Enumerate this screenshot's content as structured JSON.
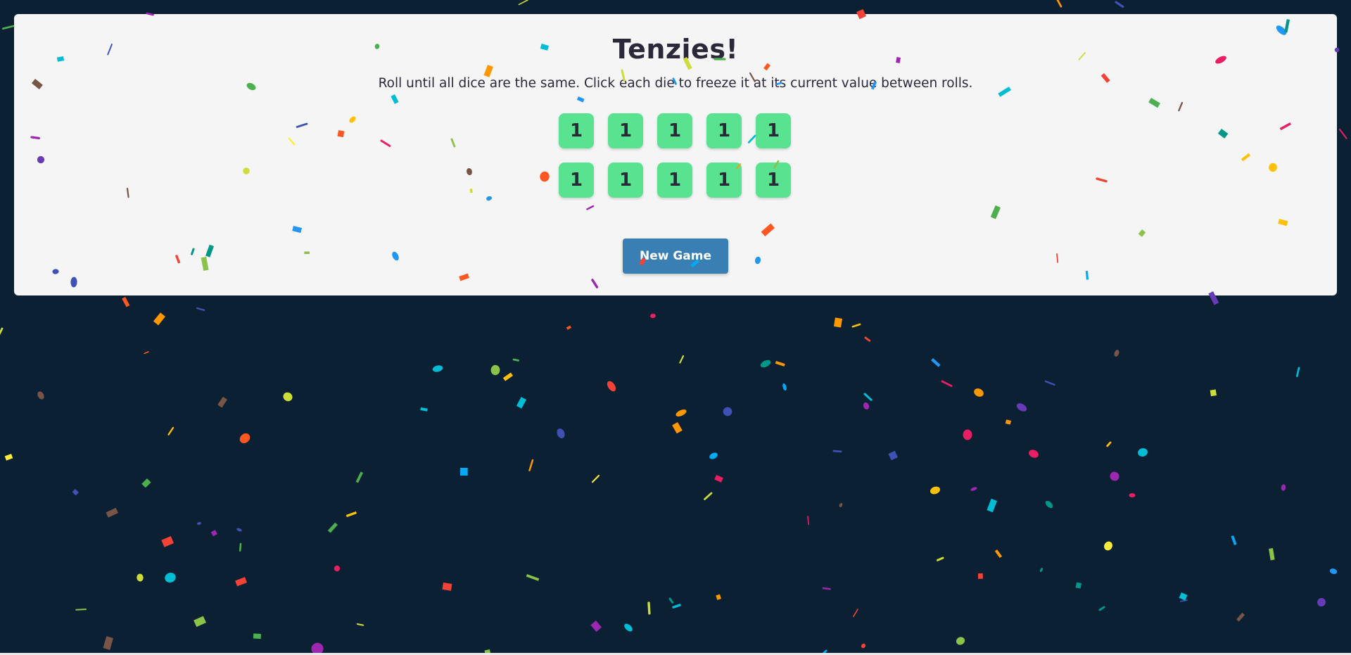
{
  "game": {
    "title": "Tenzies!",
    "instructions": "Roll until all dice are the same. Click each die to freeze it at its current value between rolls.",
    "dice": [
      "1",
      "1",
      "1",
      "1",
      "1",
      "1",
      "1",
      "1",
      "1",
      "1"
    ],
    "button_label": "New Game",
    "won": true
  },
  "theme": {
    "background": "#0b2133",
    "card": "#f5f5f5",
    "die_held": "#59e391",
    "button": "#3a7fb3",
    "text": "#2b283a"
  },
  "confetti_colors": [
    "#f44336",
    "#e91e63",
    "#9c27b0",
    "#673ab7",
    "#3f51b5",
    "#2196f3",
    "#03a9f4",
    "#00bcd4",
    "#009688",
    "#4caf50",
    "#8bc34a",
    "#cddc39",
    "#ffeb3b",
    "#ffc107",
    "#ff9800",
    "#ff5722",
    "#795548"
  ]
}
